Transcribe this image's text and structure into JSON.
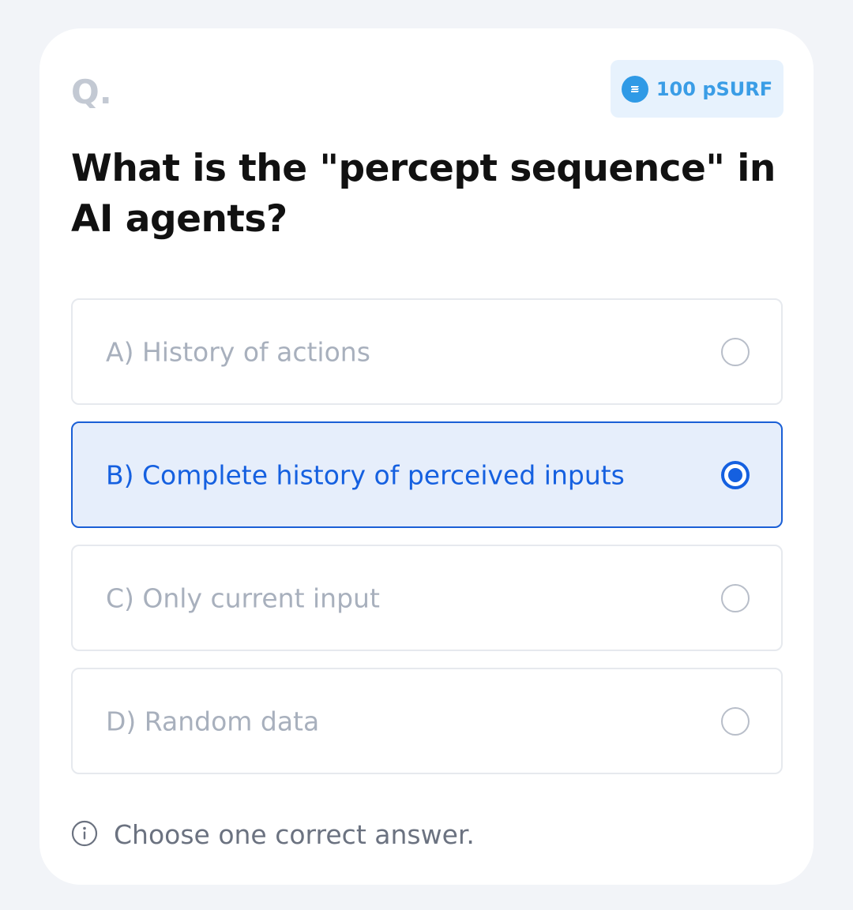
{
  "card": {
    "q_mark": "Q.",
    "reward": {
      "icon": "coin-icon",
      "label": "100 pSURF"
    },
    "question": "What is the \"percept sequence\" in AI agents?",
    "options": [
      {
        "label": "A) History of actions",
        "selected": false
      },
      {
        "label": "B) Complete history of perceived inputs",
        "selected": true
      },
      {
        "label": "C) Only current input",
        "selected": false
      },
      {
        "label": "D) Random data",
        "selected": false
      }
    ],
    "hint": {
      "icon": "info-icon",
      "text": "Choose one correct answer."
    }
  },
  "colors": {
    "accent": "#1560e0",
    "selected_bg": "#e6eefb",
    "reward_bg": "#e7f2fd",
    "reward_text": "#3a9de6",
    "page_bg": "#f2f4f8"
  }
}
